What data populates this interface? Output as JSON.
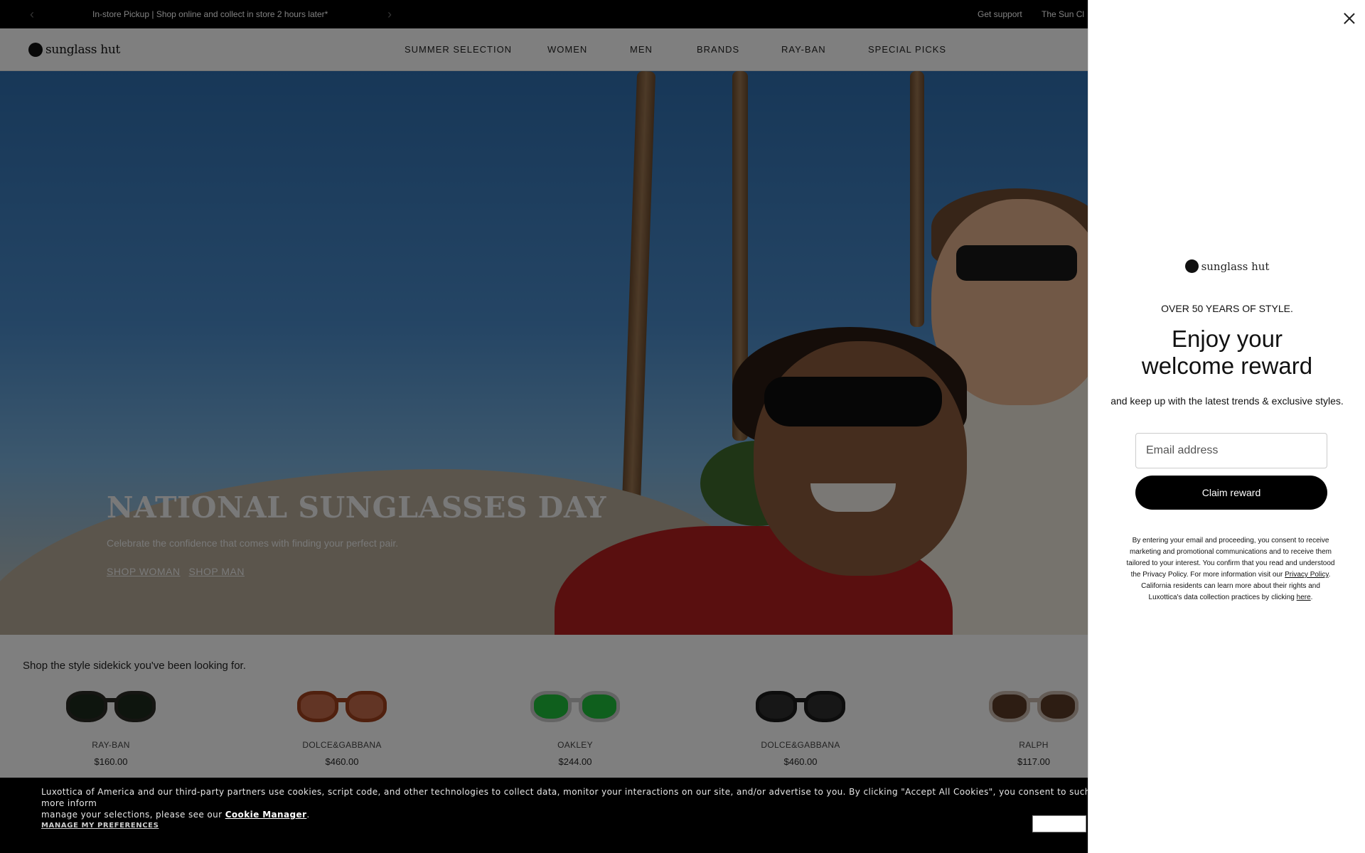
{
  "topbar": {
    "promo": "In-store Pickup | Shop online and collect in store 2 hours later*",
    "support": "Get support",
    "club": "The Sun Cl"
  },
  "header": {
    "logo": "sunglass hut",
    "nav": [
      {
        "label": "SUMMER SELECTION"
      },
      {
        "label": "WOMEN"
      },
      {
        "label": "MEN"
      },
      {
        "label": "BRANDS"
      },
      {
        "label": "RAY-BAN"
      },
      {
        "label": "SPECIAL PICKS"
      }
    ]
  },
  "hero": {
    "title": "NATIONAL SUNGLASSES DAY",
    "subtitle": "Celebrate the confidence that comes with finding your perfect pair.",
    "cta_women": "SHOP WOMAN",
    "cta_men": "SHOP MAN"
  },
  "products": {
    "heading": "Shop the style sidekick you've been looking for.",
    "items": [
      {
        "brand": "RAY-BAN",
        "price": "$160.00",
        "frame": "#2a2a24",
        "lens": "#1d2a1c"
      },
      {
        "brand": "DOLCE&GABBANA",
        "price": "$460.00",
        "frame": "#a0401c",
        "lens": "#c46a4a"
      },
      {
        "brand": "OAKLEY",
        "price": "$244.00",
        "frame": "#c9c9c9",
        "lens": "#1fbf3a"
      },
      {
        "brand": "DOLCE&GABBANA",
        "price": "$460.00",
        "frame": "#1b1b1b",
        "lens": "#2e2e2e"
      },
      {
        "brand": "RALPH",
        "price": "$117.00",
        "frame": "#c9b8ad",
        "lens": "#5a3a26"
      }
    ]
  },
  "cookie": {
    "text": "Luxottica of America and our third-party partners use cookies, script code, and other technologies to collect data, monitor your interactions on our site, and/or advertise to you. By clicking \"Accept All Cookies\", you consent to such use. For more inform",
    "text2": "manage your selections, please see our",
    "link": "Cookie Manager",
    "period": ".",
    "manage": "MANAGE MY PREFERENCES"
  },
  "panel": {
    "logo": "sunglass hut",
    "eyebrow": "OVER 50 YEARS OF STYLE.",
    "title_line1": "Enjoy your",
    "title_line2": "welcome reward",
    "subtitle": "and keep up with the latest trends & exclusive styles.",
    "email_placeholder": "Email address",
    "button": "Claim reward",
    "legal_1": "By entering your email and proceeding, you consent to receive marketing and promotional communications and to receive them tailored to your interest. You confirm that you read and understood the Privacy Policy. For more information visit our",
    "legal_link1": "Privacy Policy",
    "legal_2": ". California residents can learn more about their rights and Luxottica's data collection practices by clicking",
    "legal_link2": "here",
    "legal_3": "."
  }
}
